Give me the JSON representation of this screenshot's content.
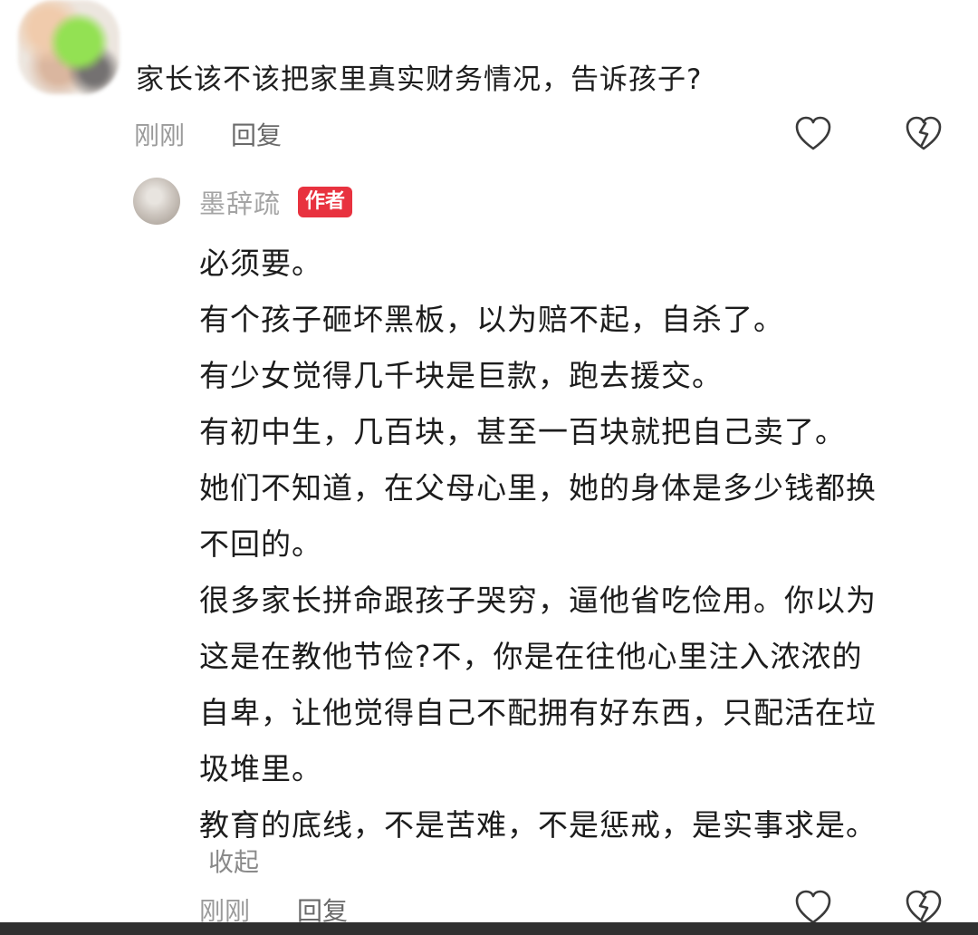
{
  "comment": {
    "text": "家长该不该把家里真实财务情况，告诉孩子?",
    "time": "刚刚",
    "reply_label": "回复"
  },
  "reply": {
    "author": "墨辞疏",
    "badge": "作者",
    "lines": [
      "必须要。",
      "有个孩子砸坏黑板，以为赔不起，自杀了。",
      "有少女觉得几千块是巨款，跑去援交。",
      "有初中生，几百块，甚至一百块就把自己卖了。",
      "她们不知道，在父母心里，她的身体是多少钱都换",
      "不回的。",
      "很多家长拼命跟孩子哭穷，逼他省吃俭用。你以为",
      "这是在教他节俭?不，你是在往他心里注入浓浓的",
      "自卑，让他觉得自己不配拥有好东西，只配活在垃",
      "圾堆里。",
      "教育的底线，不是苦难，不是惩戒，是实事求是。"
    ],
    "collapse_label": "收起",
    "time": "刚刚",
    "reply_label": "回复"
  },
  "colors": {
    "badge_bg": "#e8323f",
    "meta_text": "#9a9a9a"
  },
  "icons": [
    "heart-icon",
    "broken-heart-icon"
  ]
}
